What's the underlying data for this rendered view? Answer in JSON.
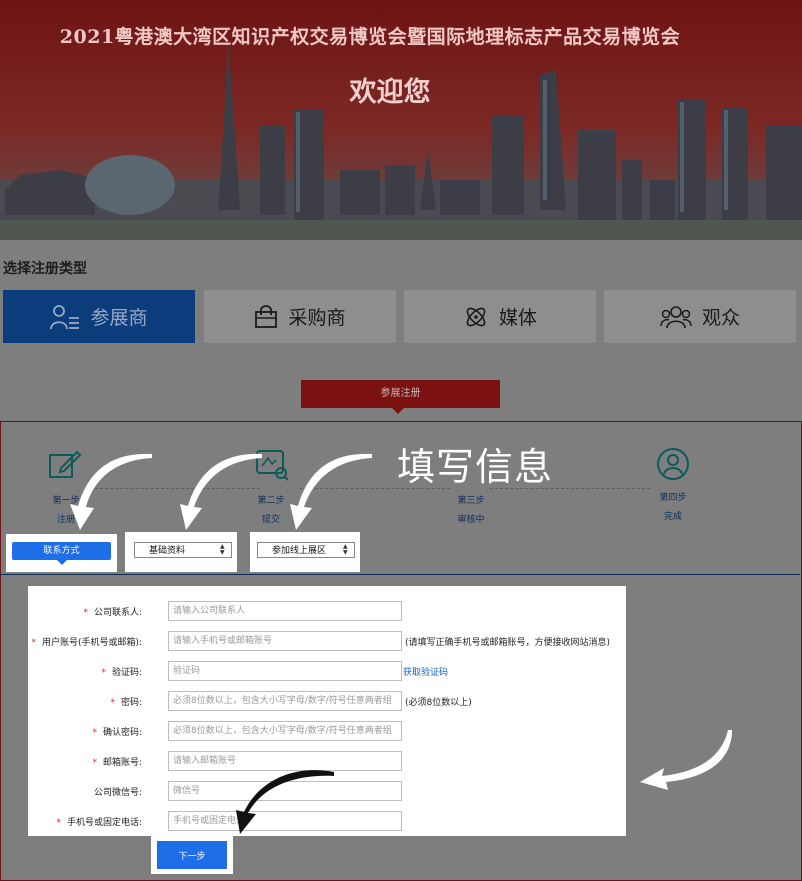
{
  "banner": {
    "title": "2021粤港澳大湾区知识产权交易博览会暨国际地理标志产品交易博览会",
    "welcome": "欢迎您"
  },
  "registration": {
    "section_title": "选择注册类型",
    "types": [
      {
        "label": "参展商",
        "icon": "exhibitor-icon",
        "active": true
      },
      {
        "label": "采购商",
        "icon": "shopping-bag-icon",
        "active": false
      },
      {
        "label": "媒体",
        "icon": "atom-icon",
        "active": false
      },
      {
        "label": "观众",
        "icon": "group-users-icon",
        "active": false
      }
    ],
    "tab_label": "参展注册"
  },
  "steps": [
    {
      "line1": "第一步",
      "line2": "注册",
      "icon": "edit-icon"
    },
    {
      "line1": "第二步",
      "line2": "提交",
      "icon": "scan-search-icon"
    },
    {
      "line1": "第三步",
      "line2": "审核中",
      "icon": "review-icon"
    },
    {
      "line1": "第四步",
      "line2": "完成",
      "icon": "user-circle-icon"
    }
  ],
  "sub_tabs": {
    "contact": "联系方式",
    "basic": "基础资料",
    "online_hall": "参加线上展区"
  },
  "callout": "填写信息",
  "form": {
    "fields": [
      {
        "label": "公司联系人:",
        "required": true,
        "placeholder": "请输入公司联系人"
      },
      {
        "label": "用户账号(手机号或邮箱):",
        "required": true,
        "placeholder": "请输入手机号或邮箱账号",
        "hint": "(请填写正确手机号或邮箱账号，方便接收网站消息)"
      },
      {
        "label": "验证码:",
        "required": true,
        "placeholder": "验证码",
        "link": "获取验证码"
      },
      {
        "label": "密码:",
        "required": true,
        "placeholder": "必须8位数以上，包含大小写字母/数字/符号任意两者组",
        "hint": "(必须8位数以上)"
      },
      {
        "label": "确认密码:",
        "required": true,
        "placeholder": "必须8位数以上，包含大小写字母/数字/符号任意两者组"
      },
      {
        "label": "邮箱账号:",
        "required": true,
        "placeholder": "请输入邮箱账号"
      },
      {
        "label": "公司微信号:",
        "required": false,
        "placeholder": "微信号"
      },
      {
        "label": "手机号或固定电话:",
        "required": true,
        "placeholder": "手机号或固定电话"
      }
    ],
    "next_label": "下一步"
  },
  "colors": {
    "overlay": "#7e7e7e",
    "active_type": "#0b3c7c",
    "tab_red": "#7b1111",
    "primary_blue": "#1d6ee8",
    "required_star": "#e02020"
  }
}
